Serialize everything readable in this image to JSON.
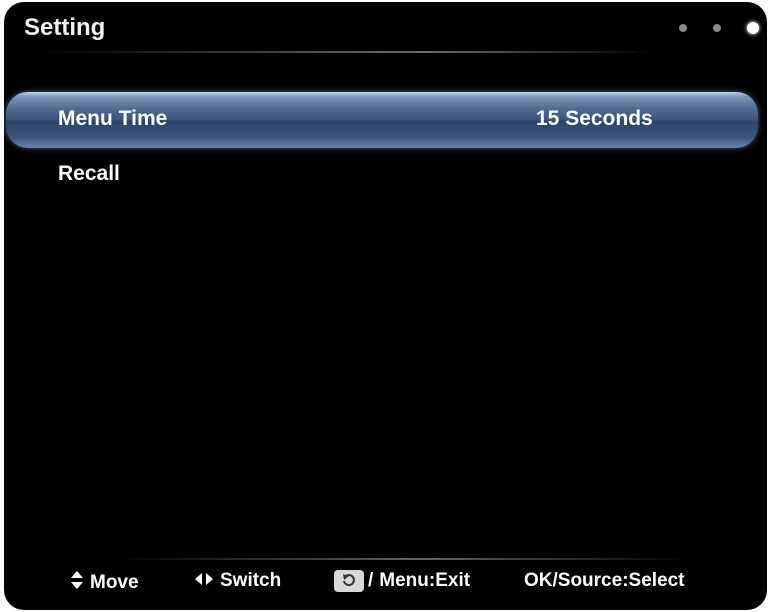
{
  "header": {
    "title": "Setting",
    "page_dots": 3,
    "active_dot": 3
  },
  "menu": {
    "items": [
      {
        "label": "Menu Time",
        "value": "15 Seconds",
        "selected": true
      },
      {
        "label": "Recall",
        "value": "",
        "selected": false
      }
    ]
  },
  "footer": {
    "move": "Move",
    "switch": "Switch",
    "exit_separator": "/",
    "exit": "Menu:Exit",
    "select": "OK/Source:Select"
  },
  "icons": {
    "move": "up-down-arrow-icon",
    "switch": "left-right-arrow-icon",
    "return": "return-icon"
  },
  "colors": {
    "background": "#000000",
    "highlight": "#3b5579",
    "text": "#ffffff"
  }
}
